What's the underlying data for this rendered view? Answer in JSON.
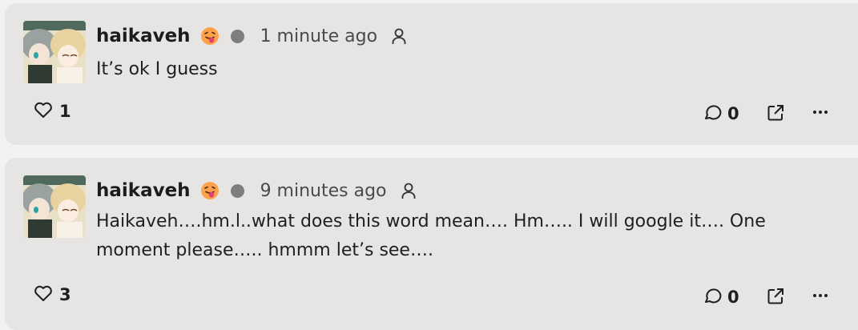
{
  "comments": [
    {
      "username": "haikaveh",
      "time": "1 minute ago",
      "text": "It’s ok I guess",
      "likes": "1",
      "replies": "0"
    },
    {
      "username": "haikaveh",
      "time": "9 minutes ago",
      "text": "Haikaveh….hm.l..what does this word mean…. Hm….. I will google it…. One moment please….. hmmm let’s see….",
      "likes": "3",
      "replies": "0"
    }
  ],
  "icons": {
    "emoji": "tongue-out-emoji-icon",
    "status": "status-dot-icon",
    "person": "person-icon",
    "like": "heart-icon",
    "comment": "comment-bubble-icon",
    "share": "external-link-icon",
    "more": "more-dots-icon"
  },
  "colors": {
    "card_bg": "#e6e5e4",
    "page_bg": "#f3f2f1",
    "status_dot": "#7e7e7e",
    "text": "#1f1f1f"
  }
}
